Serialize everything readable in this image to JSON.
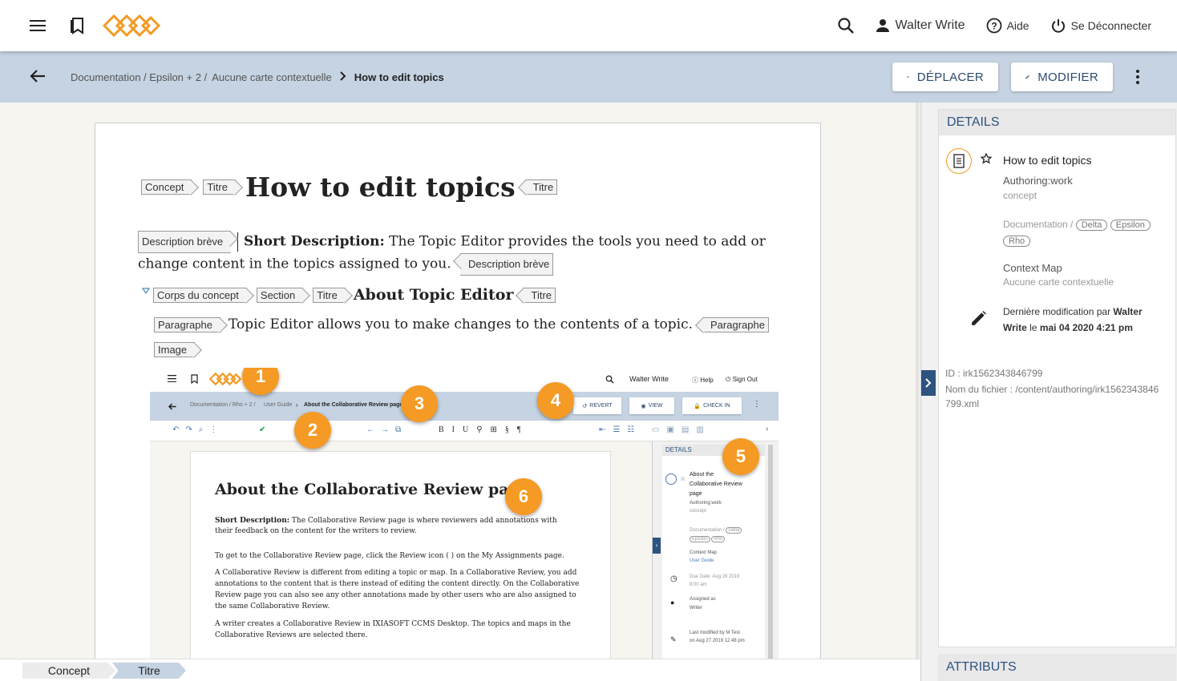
{
  "topbar": {
    "user": "Walter Write",
    "help": "Aide",
    "logout": "Se Déconnecter"
  },
  "toolbar": {
    "breadcrumb_root": "Documentation / Epsilon + 2 /",
    "breadcrumb_map": "Aucune carte contextuelle",
    "breadcrumb_current": "How to edit topics",
    "move_label": "DÉPLACER",
    "edit_label": "MODIFIER"
  },
  "doc": {
    "tag_concept": "Concept",
    "tag_title": "Titre",
    "title": "How to edit topics",
    "tag_shortdesc": "Description brève",
    "shortdesc_label": "Short Description:",
    "shortdesc_text": " The Topic Editor provides the tools you need to add or change content in the topics assigned to you.",
    "tag_conbody": "Corps du concept",
    "tag_section": "Section",
    "section_title": "About Topic Editor",
    "tag_para": "Paragraphe",
    "para_text": "Topic Editor allows you to make changes to the contents of a topic.",
    "tag_image": "Image"
  },
  "screenshot": {
    "user": "Walter Write",
    "help": "Help",
    "signout": "Sign Out",
    "crumb_root": "Documentation / Rho + 2 /",
    "crumb_map": "User Guide",
    "crumb_current": "About the Collaborative Review page",
    "revert": "REVERT",
    "view": "VIEW",
    "checkin": "CHECK IN",
    "title": "About the Collaborative Review page",
    "p1_label": "Short Description:",
    "p1": " The Collaborative Review page is where reviewers add annotations with their feedback on the content for the writers to review.",
    "p2": "To get to the Collaborative Review page, click the Review icon (  ) on the My Assignments page.",
    "p3": "A Collaborative Review is different from editing a topic or map. In a Collaborative Review, you add annotations to the content that is there instead of editing the content directly. On the Collaborative Review page you can also see any other annotations made by other users who are also assigned to the same Collaborative Review.",
    "p4": "A writer creates a Collaborative Review in IXIASOFT CCMS Desktop. The topics and maps in the Collaborative Reviews are selected there.",
    "details": "DETAILS",
    "d_title": "About the Collaborative Review page",
    "d_status": "Authoring:work",
    "d_type": "concept",
    "d_path": "Documentation /",
    "d_chip1": "Delta",
    "d_chip2": "Epsilon",
    "d_chip3": "Rho",
    "d_map_label": "Context Map",
    "d_map": "User Guide",
    "d_due": "Due Date: Aug 28 2019 8:00 am",
    "d_assigned": "Assigned as",
    "d_role": "Writer",
    "d_mod": "Last modified by M Test on Aug 27 2019 12:48 pm",
    "badges": [
      "1",
      "2",
      "3",
      "4",
      "5",
      "6"
    ]
  },
  "statusbar": {
    "crumb1": "Concept",
    "crumb2": "Titre"
  },
  "details": {
    "header": "DETAILS",
    "title": "How to edit topics",
    "status": "Authoring:work",
    "type": "concept",
    "path": "Documentation /",
    "chip1": "Delta",
    "chip2": "Epsilon",
    "chip3": "Rho",
    "map_label": "Context Map",
    "map_value": "Aucune carte contextuelle",
    "mod_prefix": "Dernière modification par ",
    "mod_user": "Walter Write",
    "mod_mid": " le ",
    "mod_date": "mai 04 2020 4:21 pm",
    "id": "ID : irk1562343846799",
    "filename": "Nom du fichier : /content/authoring/irk1562343846799.xml",
    "attributes": "ATTRIBUTS"
  },
  "colors": {
    "accent": "#2d5380",
    "toolbar_bg": "#c5d3e2",
    "logo": "#f59a24",
    "badge": "#f59a24"
  }
}
